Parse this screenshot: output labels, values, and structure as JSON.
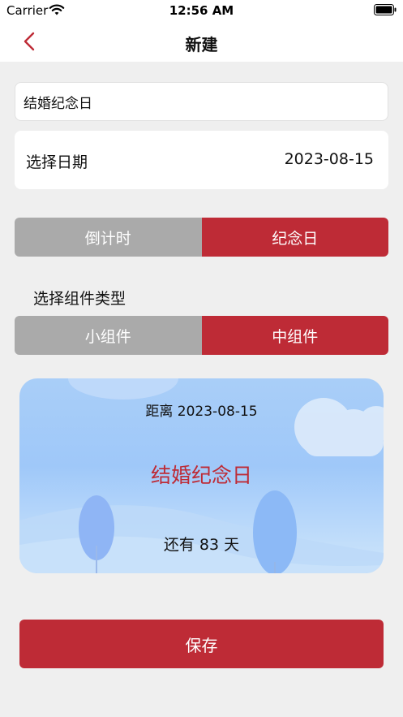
{
  "status_bar": {
    "carrier": "Carrier",
    "time": "12:56 AM"
  },
  "nav": {
    "title": "新建"
  },
  "form": {
    "name_value": "结婚纪念日",
    "date_label": "选择日期",
    "date_value": "2023-08-15"
  },
  "mode_toggle": {
    "options": [
      "倒计时",
      "纪念日"
    ],
    "selected": "纪念日"
  },
  "widget_type": {
    "label": "选择组件类型",
    "options": [
      "小组件",
      "中组件"
    ],
    "selected": "中组件"
  },
  "preview": {
    "distance_text": "距离 2023-08-15",
    "title": "结婚纪念日",
    "remaining_text": "还有 83 天"
  },
  "save_label": "保存",
  "colors": {
    "accent": "#be2b36",
    "segment_off": "#aaaaaa",
    "background": "#efefef"
  }
}
